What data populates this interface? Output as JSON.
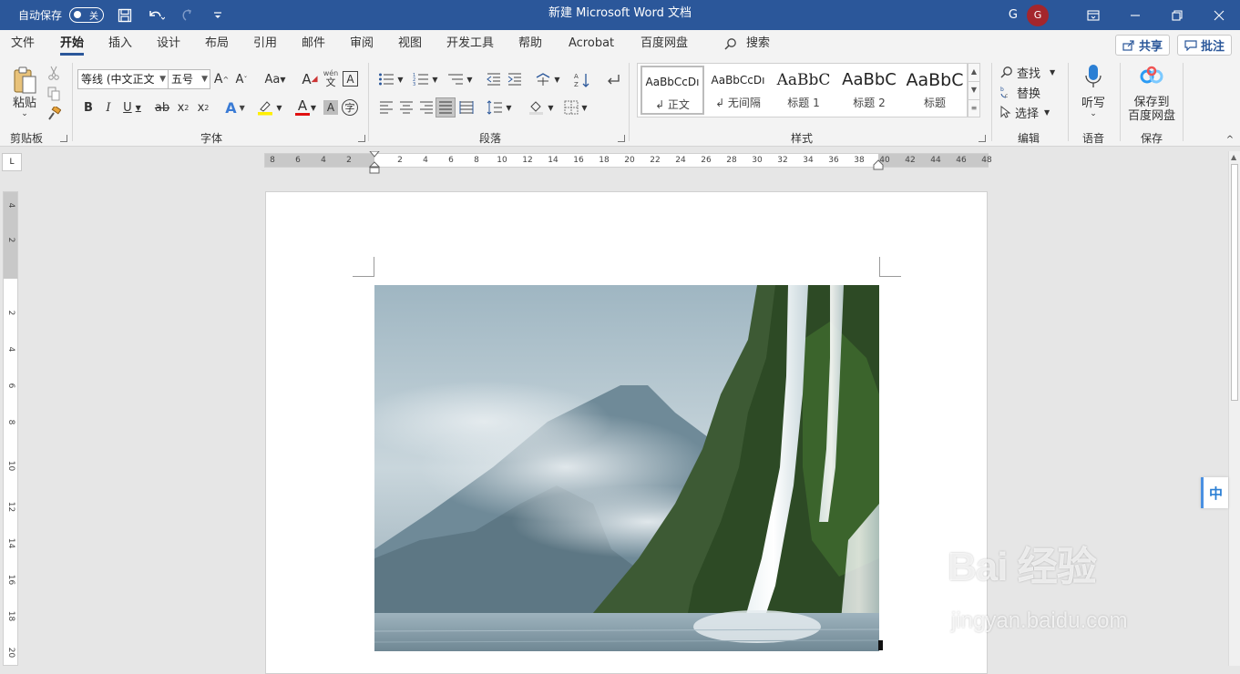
{
  "titlebar": {
    "autosave_label": "自动保存",
    "autosave_state": "关",
    "doc_title": "新建 Microsoft Word 文档",
    "user_initial": "G",
    "avatar_initial": "G",
    "bg_color": "#2b579a"
  },
  "menu": {
    "tabs": [
      "文件",
      "开始",
      "插入",
      "设计",
      "布局",
      "引用",
      "邮件",
      "审阅",
      "视图",
      "开发工具",
      "帮助",
      "Acrobat",
      "百度网盘"
    ],
    "active_tab": "开始",
    "search_label": "搜索",
    "share_label": "共享",
    "comment_label": "批注"
  },
  "ribbon": {
    "clipboard": {
      "paste_label": "粘贴",
      "group_label": "剪贴板"
    },
    "font": {
      "font_name": "等线 (中文正文",
      "font_size": "五号",
      "case_label": "Aa",
      "group_label": "字体",
      "phonetic_label": "wén"
    },
    "paragraph": {
      "group_label": "段落"
    },
    "styles": {
      "items": [
        {
          "preview": "AaBbCcDı",
          "name": "↲ 正文"
        },
        {
          "preview": "AaBbCcDı",
          "name": "↲ 无间隔"
        },
        {
          "preview": "AaBbC",
          "name": "标题 1"
        },
        {
          "preview": "AaBbC",
          "name": "标题 2"
        },
        {
          "preview": "AaBbC",
          "name": "标题"
        }
      ],
      "group_label": "样式"
    },
    "editing": {
      "find_label": "查找",
      "replace_label": "替换",
      "select_label": "选择",
      "group_label": "编辑"
    },
    "voice": {
      "dictate_label": "听写",
      "group_label": "语音"
    },
    "save": {
      "save_label_1": "保存到",
      "save_label_2": "百度网盘",
      "group_label": "保存"
    }
  },
  "ruler": {
    "corner_label": "L",
    "h_ticks": [
      "8",
      "6",
      "4",
      "2",
      "2",
      "4",
      "6",
      "8",
      "10",
      "12",
      "14",
      "16",
      "18",
      "20",
      "22",
      "24",
      "26",
      "28",
      "30",
      "32",
      "34",
      "36",
      "38",
      "40",
      "42",
      "44",
      "46",
      "48"
    ],
    "v_ticks": [
      "4",
      "2",
      "2",
      "4",
      "6",
      "8",
      "10",
      "12",
      "14",
      "16",
      "18",
      "20"
    ]
  },
  "ime": {
    "label": "中"
  },
  "watermark": {
    "main": "Bai 经验",
    "sub": "jingyan.baidu.com"
  }
}
